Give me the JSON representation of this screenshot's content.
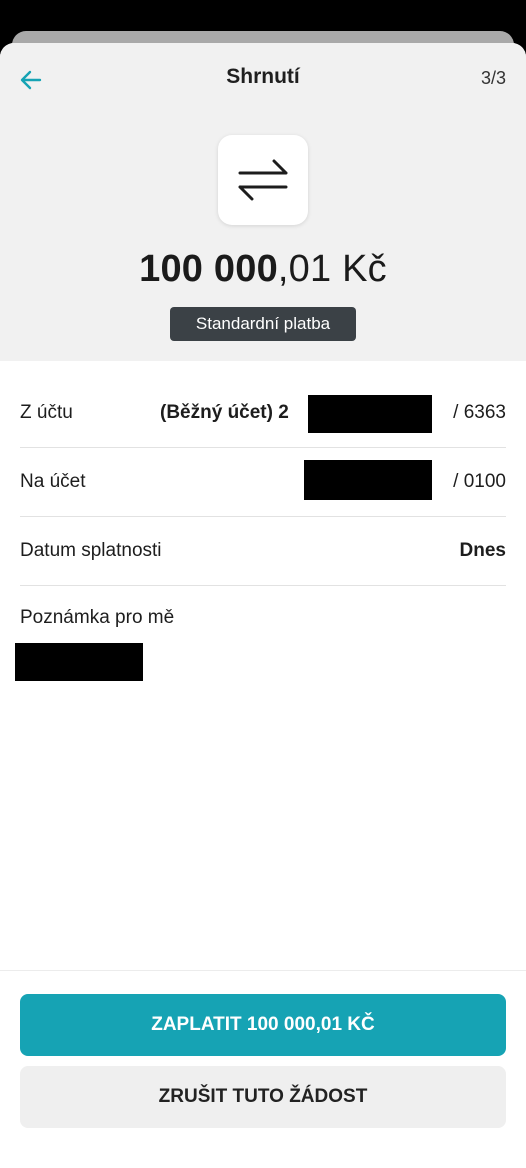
{
  "header": {
    "title": "Shrnutí",
    "step": "3/3",
    "back_icon": "arrow-left-icon"
  },
  "summary": {
    "icon": "transfer-arrows-icon",
    "amount_integer": "100 000",
    "amount_decimal": ",01",
    "currency": "Kč",
    "payment_type": "Standardní platba"
  },
  "details": {
    "from_account": {
      "label": "Z účtu",
      "value_prefix": "(Běžný účet) 2",
      "value_suffix": "/ 6363"
    },
    "to_account": {
      "label": "Na účet",
      "value_suffix": "/ 0100"
    },
    "due_date": {
      "label": "Datum splatnosti",
      "value": "Dnes"
    },
    "note": {
      "label": "Poznámka pro mě"
    }
  },
  "actions": {
    "pay_label": "ZAPLATIT 100 000,01 KČ",
    "cancel_label": "ZRUŠIT TUTO ŽÁDOST"
  },
  "colors": {
    "accent": "#16a3b4",
    "badge_bg": "#3b4146",
    "header_bg": "#f1f1f1"
  }
}
